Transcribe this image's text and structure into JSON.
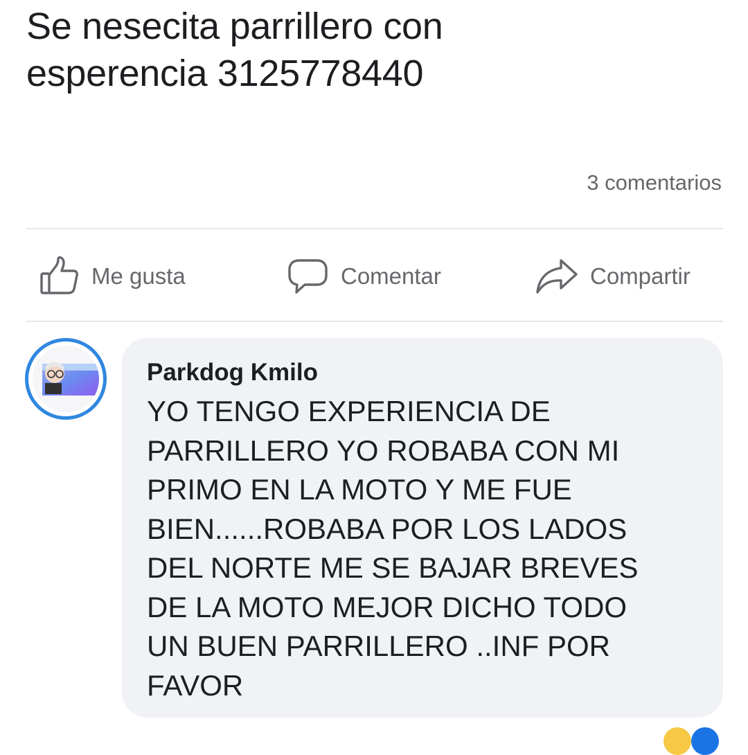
{
  "post": {
    "text_lines": [
      "Se nesecita parrillero con",
      "esperencia 3125778440"
    ]
  },
  "stats": {
    "comments": "3 comentarios"
  },
  "actions": {
    "like": "Me gusta",
    "comment": "Comentar",
    "share": "Compartir"
  },
  "comment": {
    "author": "Parkdog Kmilo",
    "body_lines": [
      "YO TENGO EXPERIENCIA DE",
      "PARRILLERO YO ROBABA CON MI",
      "PRIMO EN LA MOTO Y ME FUE",
      "BIEN......ROBABA POR LOS LADOS",
      "DEL NORTE ME SE BAJAR BREVES",
      "DE LA MOTO MEJOR DICHO TODO",
      "UN BUEN PARRILLERO ..INF POR",
      "FAVOR"
    ]
  },
  "icons": {
    "like": "thumbs-up-icon",
    "comment": "speech-bubble-icon",
    "share": "share-arrow-icon"
  },
  "colors": {
    "text": "#1c1e21",
    "secondary_text": "#65676b",
    "bubble_bg": "#f0f2f5",
    "avatar_ring": "#2f87e0",
    "divider": "#e4e6eb"
  }
}
